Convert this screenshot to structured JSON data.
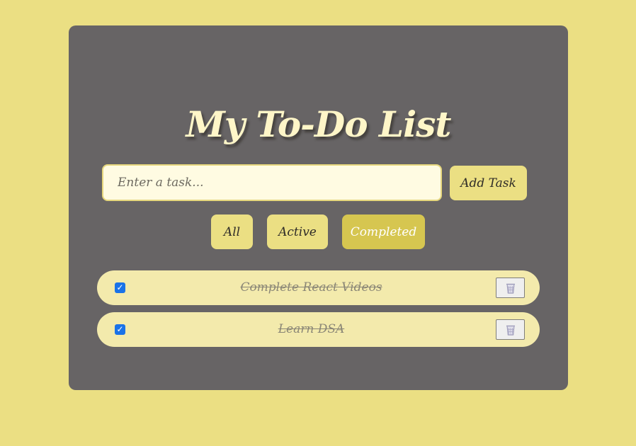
{
  "app": {
    "title": "My To-Do List"
  },
  "input": {
    "placeholder": "Enter a task...",
    "value": ""
  },
  "toolbar": {
    "add_label": "Add Task"
  },
  "filters": [
    {
      "label": "All",
      "selected": false
    },
    {
      "label": "Active",
      "selected": false
    },
    {
      "label": "Completed",
      "selected": true
    }
  ],
  "tasks": [
    {
      "text": "Complete React Videos",
      "completed": true,
      "delete_icon": "trash-icon"
    },
    {
      "text": "Learn DSA",
      "completed": true,
      "delete_icon": "trash-icon"
    }
  ],
  "colors": {
    "background": "#ebdf83",
    "card": "#676465",
    "accent": "#d6c650",
    "checkbox": "#1a73e8",
    "task_bg": "#f3eaac"
  }
}
